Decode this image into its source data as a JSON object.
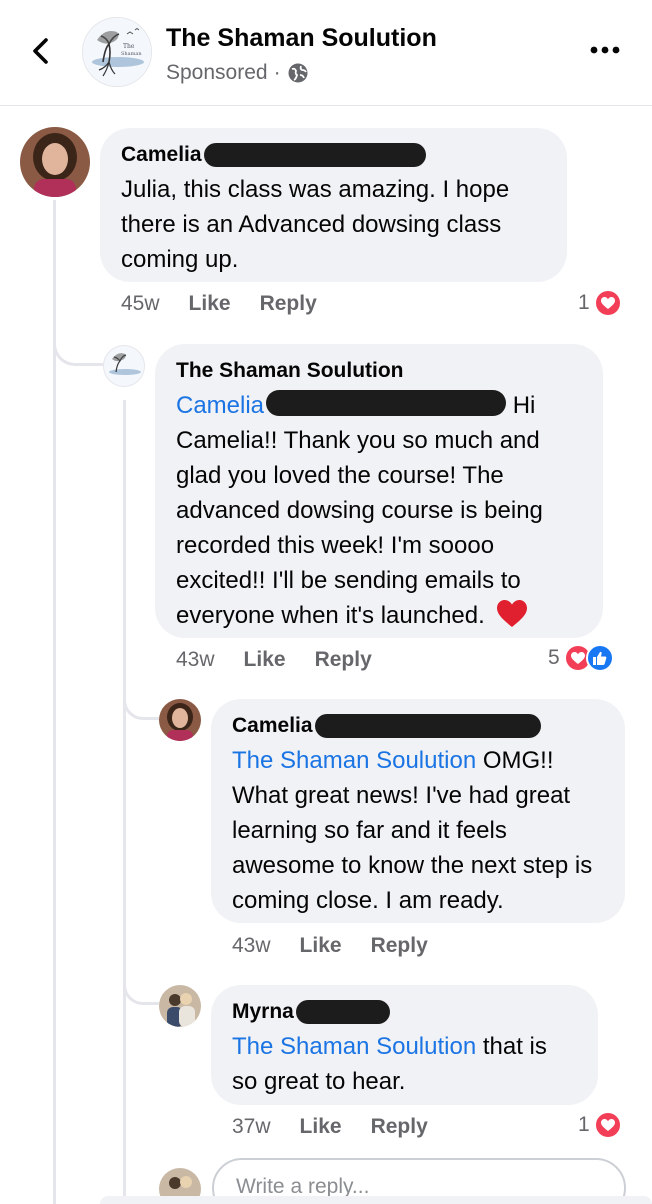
{
  "header": {
    "page_name": "The Shaman Soulution",
    "sponsored_label": "Sponsored",
    "separator": "·"
  },
  "comments": [
    {
      "author": "Camelia",
      "text": "Julia, this class was amazing. I hope there is an Advanced dowsing class coming up.",
      "time": "45w",
      "like_label": "Like",
      "reply_label": "Reply",
      "reaction_count": "1"
    },
    {
      "author": "The Shaman Soulution",
      "mention": "Camelia",
      "text_after_mention": "Hi Camelia!! Thank you so much and glad you loved the course! The advanced dowsing course is being recorded this week! I'm soooo excited!! I'll be sending emails to everyone when it's launched.",
      "time": "43w",
      "like_label": "Like",
      "reply_label": "Reply",
      "reaction_count": "5"
    },
    {
      "author": "Camelia",
      "mention": "The Shaman Soulution",
      "text_after_mention": "OMG!! What great news! I've had great learning so far and it feels awesome to know the next step is coming close. I am ready.",
      "time": "43w",
      "like_label": "Like",
      "reply_label": "Reply"
    },
    {
      "author": "Myrna",
      "mention": "The Shaman Soulution",
      "text_after_mention": "that is so great to hear.",
      "time": "37w",
      "like_label": "Like",
      "reply_label": "Reply",
      "reaction_count": "1"
    }
  ],
  "reply_input": {
    "placeholder": "Write a reply..."
  },
  "icons": {
    "back": "chevron-left-icon",
    "more": "more-dots-icon",
    "globe": "globe-icon",
    "love_reaction": "heart-reaction-icon",
    "like_reaction": "thumbs-up-reaction-icon"
  },
  "colors": {
    "mention": "#1b74e4",
    "love": "#f33e58",
    "like": "#1877f2",
    "bubble": "#f0f2f5",
    "secondary_text": "#65676b"
  }
}
